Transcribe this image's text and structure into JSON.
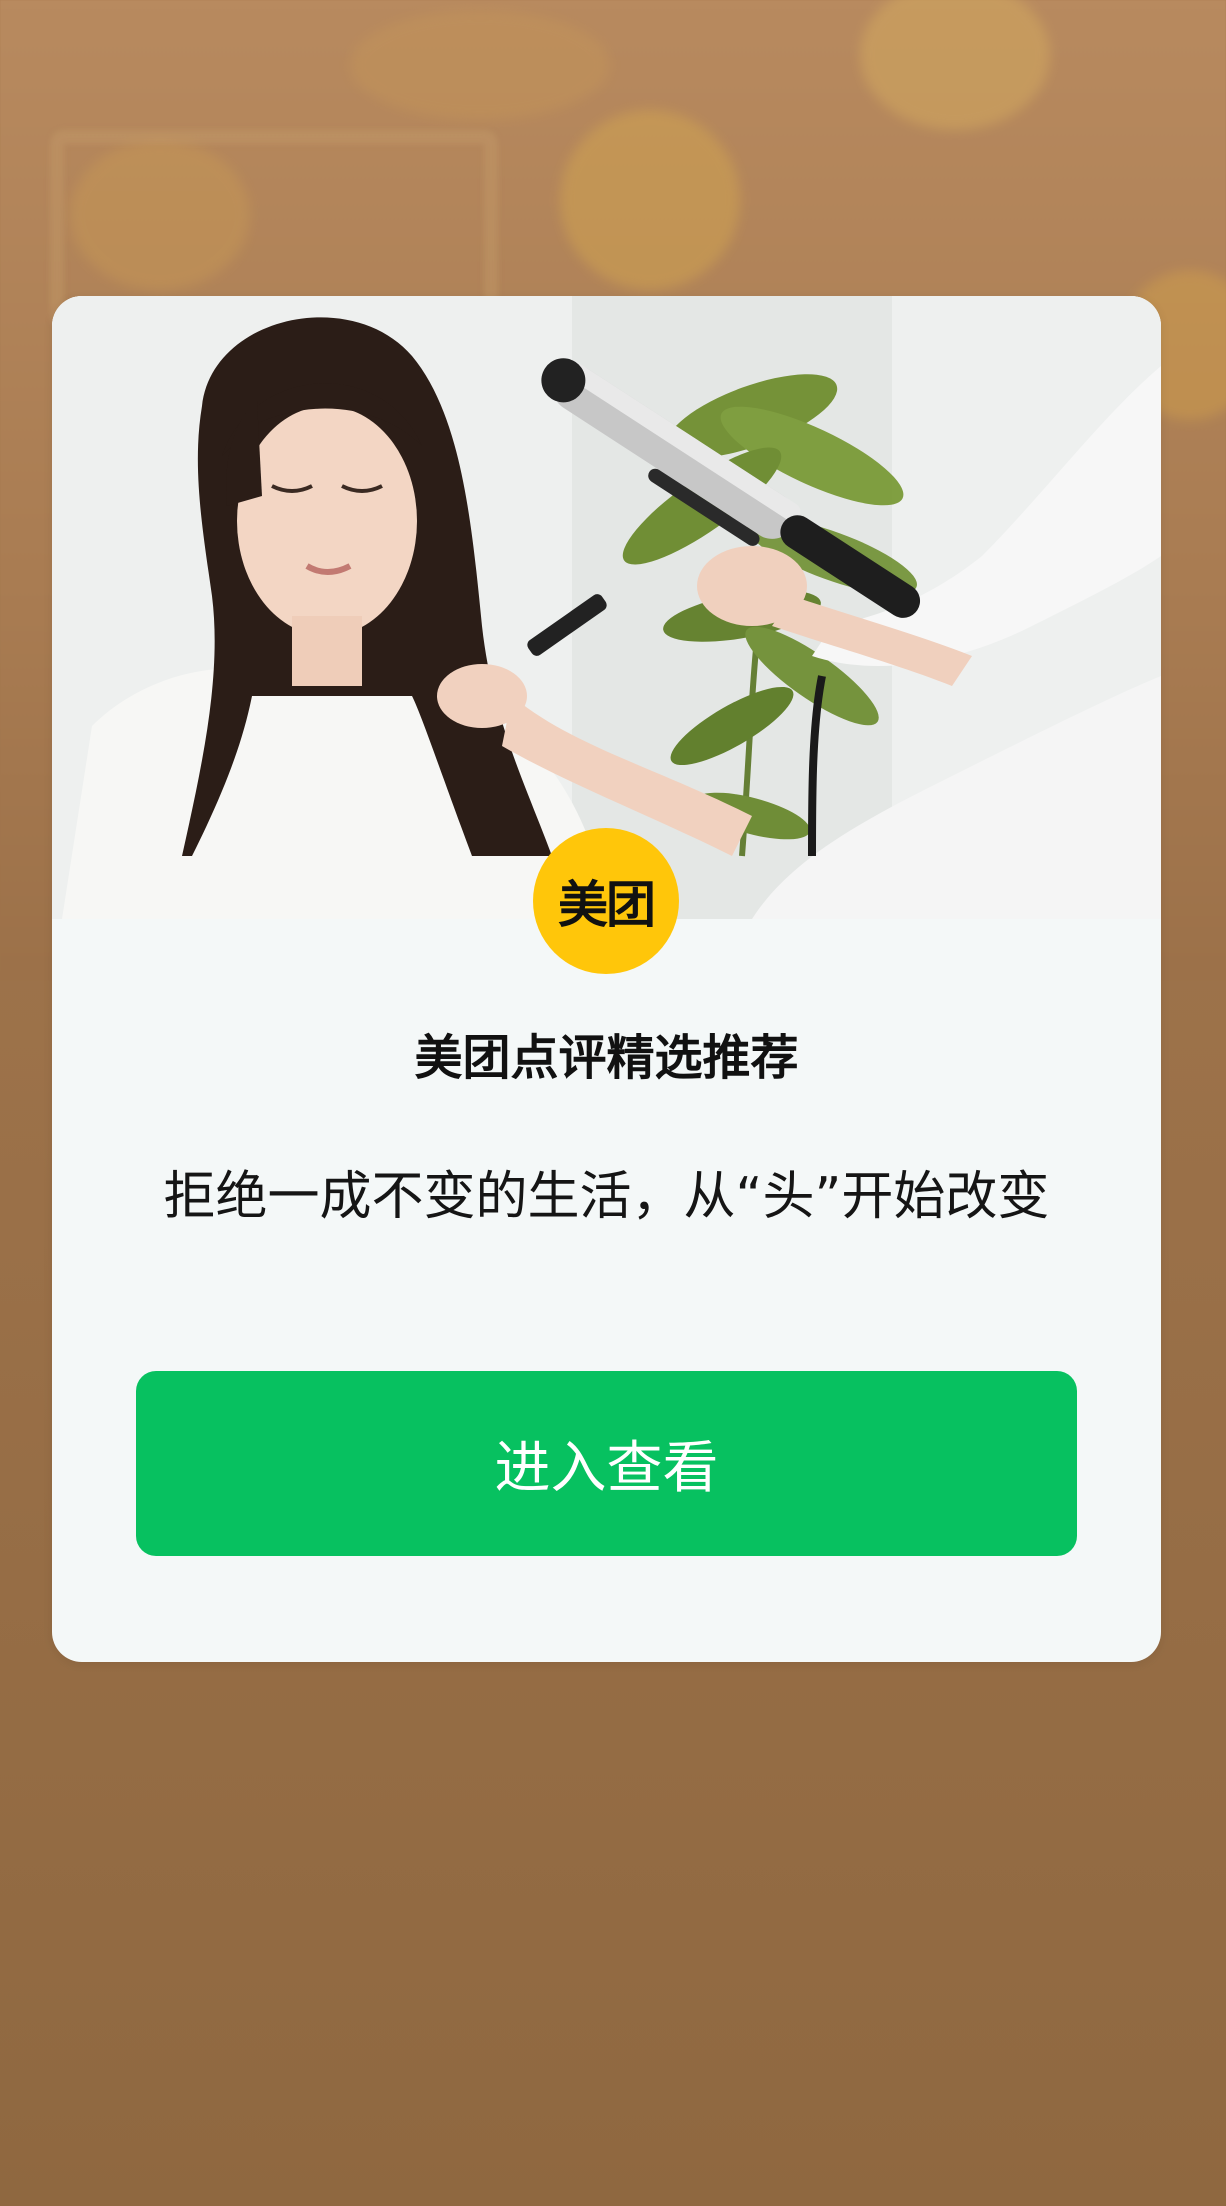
{
  "colors": {
    "background": "#946c44",
    "card": "#f4f8f8",
    "brand_yellow": "#ffc60a",
    "primary_button": "#07c160"
  },
  "logo": {
    "text": "美团"
  },
  "card": {
    "title": "美团点评精选推荐",
    "subtitle": "拒绝一成不变的生活，从“头”开始改变",
    "button_label": "进入查看"
  }
}
